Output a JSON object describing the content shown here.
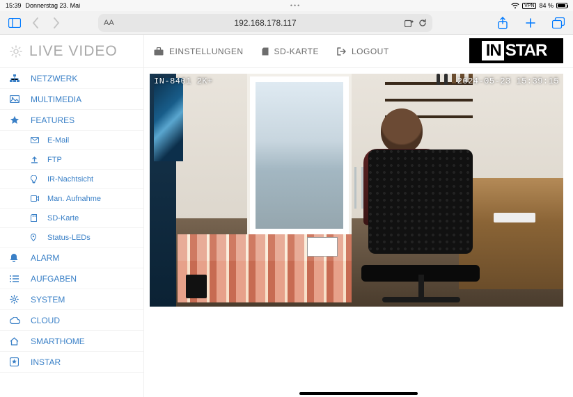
{
  "status": {
    "time": "15:39",
    "date": "Donnerstag 23. Mai",
    "vpn_label": "VPN",
    "battery_pct": "84 %"
  },
  "browser": {
    "url": "192.168.178.117",
    "aA": "AA"
  },
  "sidebar": {
    "title": "LIVE VIDEO",
    "items": [
      {
        "label": "NETZWERK"
      },
      {
        "label": "MULTIMEDIA"
      },
      {
        "label": "FEATURES"
      },
      {
        "label": "ALARM"
      },
      {
        "label": "AUFGABEN"
      },
      {
        "label": "SYSTEM"
      },
      {
        "label": "CLOUD"
      },
      {
        "label": "SMARTHOME"
      },
      {
        "label": "INSTAR"
      }
    ],
    "features_sub": [
      {
        "label": "E-Mail"
      },
      {
        "label": "FTP"
      },
      {
        "label": "IR-Nachtsicht"
      },
      {
        "label": "Man. Aufnahme"
      },
      {
        "label": "SD-Karte"
      },
      {
        "label": "Status-LEDs"
      }
    ]
  },
  "topbar": {
    "settings": "EINSTELLUNGEN",
    "sdcard": "SD-KARTE",
    "logout": "LOGOUT"
  },
  "logo": {
    "left": "IN",
    "right": "STAR"
  },
  "osd": {
    "model": "IN-8401 2K+",
    "timestamp": "2024-05-23 15:39:15"
  }
}
